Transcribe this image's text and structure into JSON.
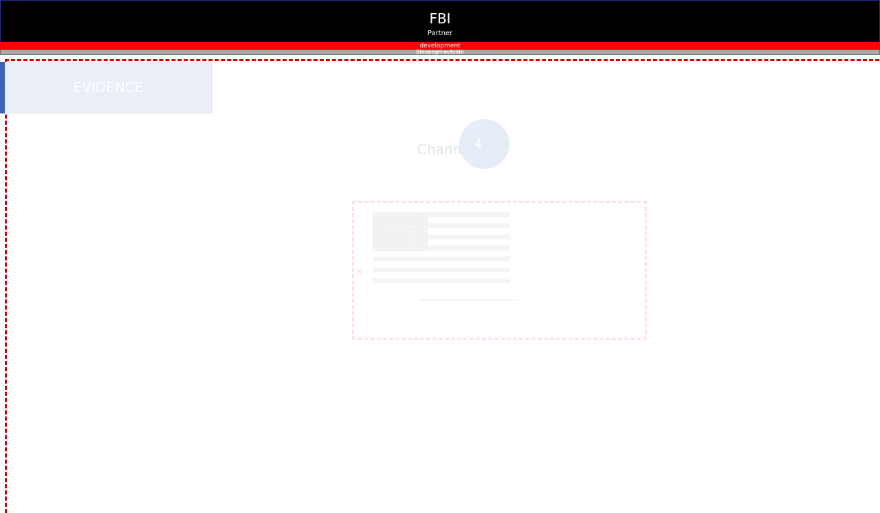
{
  "header": {
    "title": "FBI",
    "subtitle": "Partner"
  },
  "environment_banner": {
    "label": "development",
    "color": "#ff0000"
  },
  "warning_banner": {
    "label": "Sleepogn outside",
    "color": "#a9a9a9"
  },
  "sidebar": {
    "items": [
      {
        "label": "EVIDENCE",
        "active": true
      }
    ],
    "accent_color": "#3f63b4"
  },
  "main": {
    "section_title": "Chann",
    "step_badge": "4",
    "preview": {
      "icon": "us-flag-icon"
    }
  },
  "colors": {
    "header_bg": "#000000",
    "frame_dash": "#d40000",
    "nav_bg": "#e9eef7"
  }
}
